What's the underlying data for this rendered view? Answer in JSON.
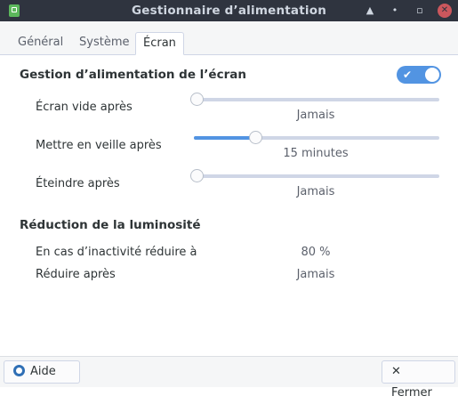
{
  "window": {
    "title": "Gestionnaire d’alimentation",
    "controls": {
      "shade": "▲",
      "minimize": "•",
      "maximize": "▫",
      "close": "✕"
    }
  },
  "tabs": [
    {
      "label": "Général"
    },
    {
      "label": "Système"
    },
    {
      "label": "Écran"
    }
  ],
  "display": {
    "section_title": "Gestion d’alimentation de l’écran",
    "toggle_on": true,
    "toggle_check": "✔",
    "blank": {
      "label": "Écran vide après",
      "value": "Jamais",
      "level": 0
    },
    "sleep": {
      "label": "Mettre en veille après",
      "value": "15 minutes",
      "level": 0.25
    },
    "off": {
      "label": "Éteindre après",
      "value": "Jamais",
      "level": 0
    }
  },
  "brightness": {
    "section_title": "Réduction de la luminosité",
    "reduce_on_inactivity": {
      "label": "En cas d’inactivité réduire à",
      "value": "80 %"
    },
    "reduce_after": {
      "label": "Réduire après",
      "value": "Jamais"
    }
  },
  "footer": {
    "help_label": "Aide",
    "close_label": "Fermer",
    "close_glyph": "✕"
  },
  "colors": {
    "accent": "#5294e2",
    "titlebar": "#2f343f",
    "close_button": "#cc575d"
  }
}
